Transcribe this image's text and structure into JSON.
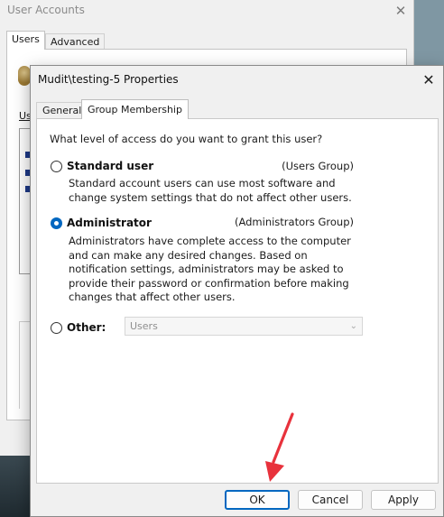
{
  "back_window": {
    "title": "User Accounts",
    "tabs": [
      {
        "label": "Users",
        "active": true
      },
      {
        "label": "Advanced",
        "active": false
      }
    ],
    "partial_label": "Us"
  },
  "dialog": {
    "title": "Mudit\\testing-5 Properties",
    "tabs": [
      {
        "label": "General",
        "active": false
      },
      {
        "label": "Group Membership",
        "active": true
      }
    ],
    "question": "What level of access do you want to grant this user?",
    "options": [
      {
        "label": "Standard user",
        "group": "(Users Group)",
        "checked": false,
        "description": "Standard account users can use most software and change system settings that do not affect other users."
      },
      {
        "label": "Administrator",
        "group": "(Administrators Group)",
        "checked": true,
        "description": "Administrators have complete access to the computer and can make any desired changes. Based on notification settings, administrators may be asked to provide their password or confirmation before making changes that affect other users."
      },
      {
        "label": "Other:",
        "checked": false
      }
    ],
    "other_select": {
      "value": "Users",
      "enabled": false
    },
    "buttons": {
      "ok": "OK",
      "cancel": "Cancel",
      "apply": "Apply"
    }
  },
  "colors": {
    "accent": "#0067c0",
    "annotation_arrow": "#e8323c"
  }
}
